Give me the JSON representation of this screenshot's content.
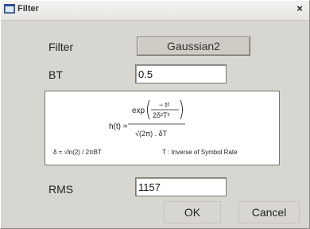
{
  "window": {
    "title": "Filter",
    "close_glyph": "×"
  },
  "fields": {
    "filter_label": "Filter",
    "filter_value": "Gaussian2",
    "bt_label": "BT",
    "bt_value": "0.5",
    "rms_label": "RMS",
    "rms_value": "1157"
  },
  "formula": {
    "lhs": "h(t) =",
    "exp": "exp",
    "exp_numerator": "− t²",
    "exp_denominator": "2δ²T²",
    "denominator": "√(2π) . δT",
    "delta_def": "δ = √ln(2) / 2πBT",
    "t_def": "T : Inverse of Symbol Rate"
  },
  "buttons": {
    "ok": "OK",
    "cancel": "Cancel"
  },
  "icons": [
    "window-app-icon",
    "close-icon"
  ]
}
